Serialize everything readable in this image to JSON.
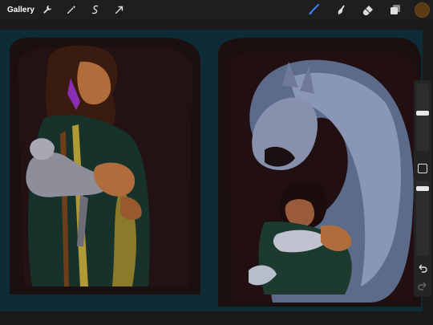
{
  "toolbar": {
    "gallery_label": "Gallery",
    "left_tools": [
      "wrench-icon",
      "magic-wand-icon",
      "selection-icon",
      "transform-arrow-icon"
    ],
    "right_tools": [
      "brush-icon",
      "smudge-icon",
      "eraser-icon",
      "layers-icon"
    ],
    "active_tool": "brush-icon",
    "accent_color": "#3b82f6",
    "current_color": "#5a3a12"
  },
  "sidebar": {
    "brush_size": 0.35,
    "opacity": 0.55,
    "controls": [
      "brush-size-slider",
      "modify-square-button",
      "opacity-slider",
      "undo-icon",
      "redo-icon"
    ]
  },
  "canvas": {
    "background_color": "#0d2c36",
    "panels": [
      "left-panel-woman-with-lamb",
      "right-panel-wolf-and-child"
    ]
  }
}
